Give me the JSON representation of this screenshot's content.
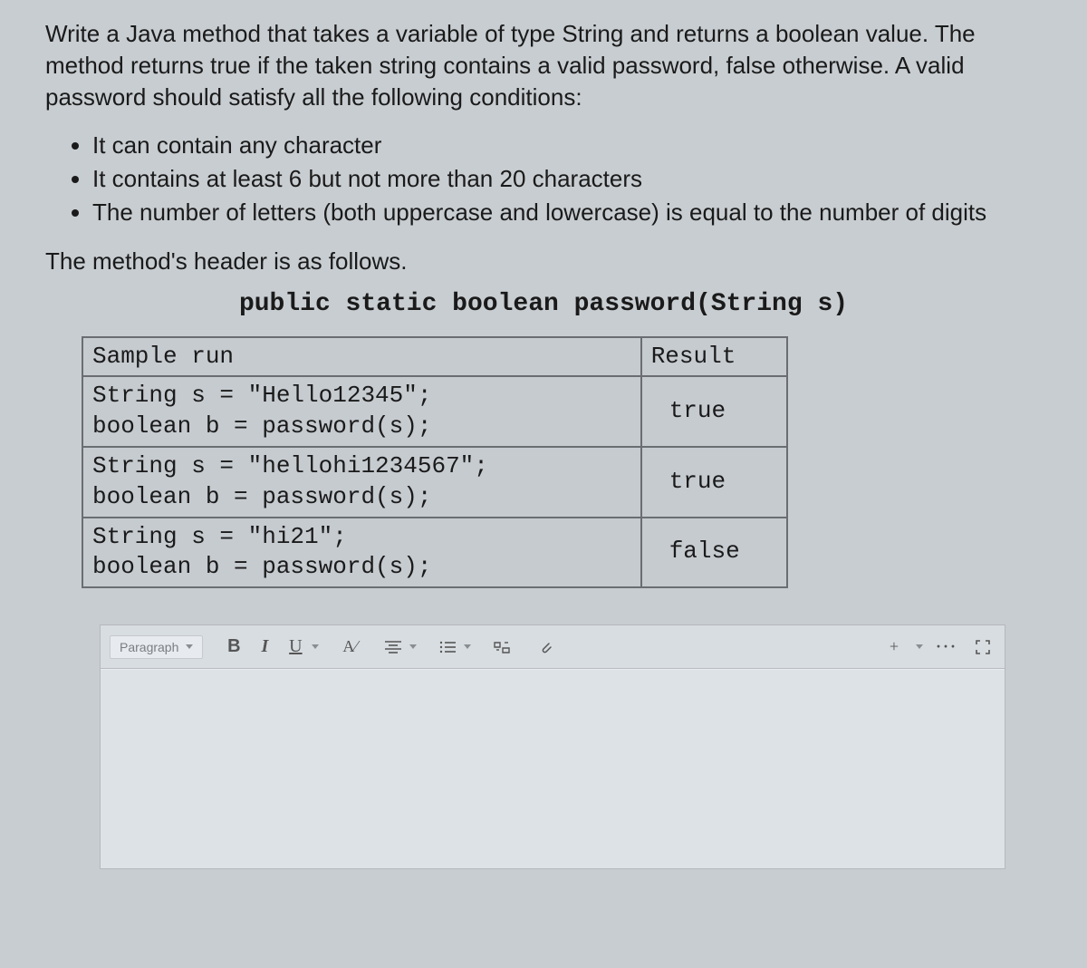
{
  "question": {
    "intro": "Write a Java method that takes a variable of type String and returns a boolean value. The method returns true if the taken string contains a valid password, false otherwise. A valid password should satisfy all the following conditions:",
    "conditions": [
      "It can contain any character",
      "It contains at least 6 but not more than 20 characters",
      "The number of letters (both uppercase and lowercase) is equal to the number of digits"
    ],
    "header_intro": "The method's header is as follows.",
    "code_header": "public static boolean password(String s)"
  },
  "table": {
    "head_sample": "Sample run",
    "head_result": "Result",
    "rows": [
      {
        "sample": "String s = \"Hello12345\";\nboolean b = password(s);",
        "result": "true"
      },
      {
        "sample": "String s = \"hellohi1234567\";\nboolean b = password(s);",
        "result": "true"
      },
      {
        "sample": "String s = \"hi21\";\nboolean b = password(s);",
        "result": "false"
      }
    ]
  },
  "toolbar": {
    "paragraph": "Paragraph",
    "bold": "B",
    "italic": "I",
    "underline": "U",
    "font_a": "A⁄",
    "plus": "+",
    "more": "···"
  }
}
